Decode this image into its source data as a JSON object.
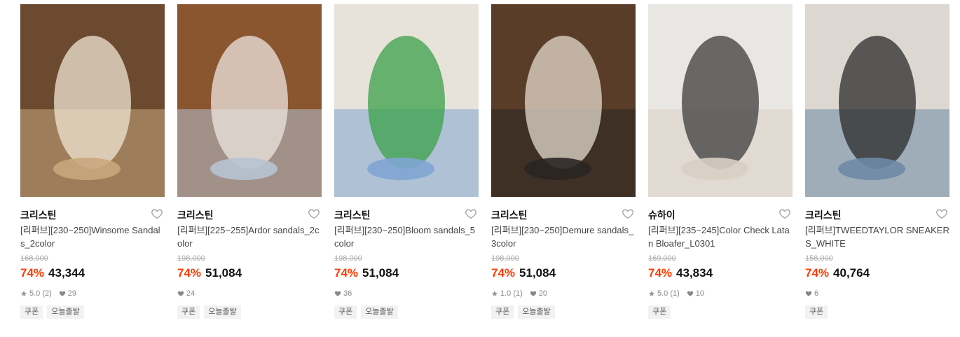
{
  "products": [
    {
      "brand": "크리스틴",
      "name": "[리퍼브][230~250]Winsome Sandals_2color",
      "original_price": "168,000",
      "discount": "74%",
      "price": "43,344",
      "rating": "5.0 (2)",
      "likes": "29",
      "tags": [
        "쿠폰",
        "오늘출발"
      ],
      "image_icon": "woman-sitting-wooden-steps-photo",
      "palette": {
        "bg": "#6b4a30",
        "mid": "#c9a77d",
        "fg": "#f0e6d3"
      }
    },
    {
      "brand": "크리스틴",
      "name": "[리퍼브][225~255]Ardor sandals_2color",
      "original_price": "198,000",
      "discount": "74%",
      "price": "51,084",
      "rating": "",
      "likes": "24",
      "tags": [
        "쿠폰",
        "오늘출발"
      ],
      "image_icon": "woman-on-stairs-photo",
      "palette": {
        "bg": "#8a5630",
        "mid": "#b7c3d3",
        "fg": "#ece6e0"
      }
    },
    {
      "brand": "크리스틴",
      "name": "[리퍼브][230~250]Bloom sandals_5color",
      "original_price": "198,000",
      "discount": "74%",
      "price": "51,084",
      "rating": "",
      "likes": "36",
      "tags": [
        "쿠폰",
        "오늘출발"
      ],
      "image_icon": "slide-sandals-on-linen-photo",
      "palette": {
        "bg": "#e8e3da",
        "mid": "#7fa5d1",
        "fg": "#3aa048"
      }
    },
    {
      "brand": "크리스틴",
      "name": "[리퍼브][230~250]Demure sandals_3color",
      "original_price": "198,000",
      "discount": "74%",
      "price": "51,084",
      "rating": "1.0 (1)",
      "likes": "20",
      "tags": [
        "쿠폰",
        "오늘출발"
      ],
      "image_icon": "woman-in-black-crouching-photo",
      "palette": {
        "bg": "#5a3d28",
        "mid": "#2a2624",
        "fg": "#e4d9cd"
      }
    },
    {
      "brand": "슈하이",
      "name": "[리퍼브][235~245]Color Check Latan Bloafer_L0301",
      "original_price": "169,000",
      "discount": "74%",
      "price": "43,834",
      "rating": "5.0 (1)",
      "likes": "10",
      "tags": [
        "쿠폰"
      ],
      "image_icon": "feet-on-white-stairs-photo",
      "palette": {
        "bg": "#e9e7e3",
        "mid": "#d9cfc4",
        "fg": "#3c3c3c"
      }
    },
    {
      "brand": "크리스틴",
      "name": "[리퍼브]TWEEDTAYLOR SNEAKERS_WHITE",
      "original_price": "158,000",
      "discount": "74%",
      "price": "40,764",
      "rating": "",
      "likes": "6",
      "tags": [
        "쿠폰"
      ],
      "image_icon": "tweed-sneakers-photo",
      "palette": {
        "bg": "#dcd8d1",
        "mid": "#6e8aa6",
        "fg": "#2b2b2b"
      }
    }
  ],
  "icons": {
    "wishlist": "heart-outline-icon",
    "rating": "star-icon",
    "likes": "heart-icon"
  },
  "colors": {
    "discount": "#ff3c00",
    "strike": "#aaaaaa",
    "tag_bg": "#f2f2f2"
  }
}
